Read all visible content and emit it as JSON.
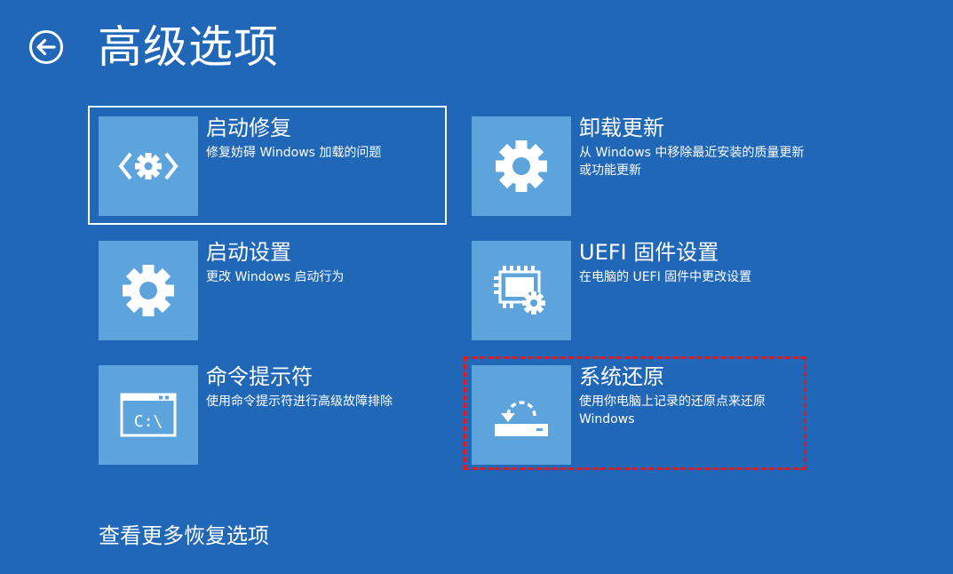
{
  "header": {
    "title": "高级选项",
    "back_icon": "back-arrow-icon"
  },
  "options": [
    {
      "title": "启动修复",
      "description": "修复妨碍 Windows 加载的问题",
      "icon": "startup-repair-icon",
      "selected": true
    },
    {
      "title": "卸载更新",
      "description": "从 Windows 中移除最近安装的质量更新或功能更新",
      "icon": "gear-icon",
      "selected": false
    },
    {
      "title": "启动设置",
      "description": "更改 Windows 启动行为",
      "icon": "gear-icon",
      "selected": false
    },
    {
      "title": "UEFI 固件设置",
      "description": "在电脑的 UEFI 固件中更改设置",
      "icon": "firmware-chip-gear-icon",
      "selected": false
    },
    {
      "title": "命令提示符",
      "description": "使用命令提示符进行高级故障排除",
      "icon": "command-prompt-icon",
      "icon_text": "C:\\",
      "selected": false
    },
    {
      "title": "系统还原",
      "description": "使用你电脑上记录的还原点来还原 Windows",
      "icon": "system-restore-icon",
      "selected": false,
      "highlighted": true
    }
  ],
  "footer": {
    "more_options_label": "查看更多恢复选项"
  },
  "colors": {
    "background": "#2067b8",
    "tile_icon_background": "#5ea4dc",
    "text": "#ffffff",
    "selection_border": "#ffffff",
    "highlight_border": "#e01b24"
  }
}
